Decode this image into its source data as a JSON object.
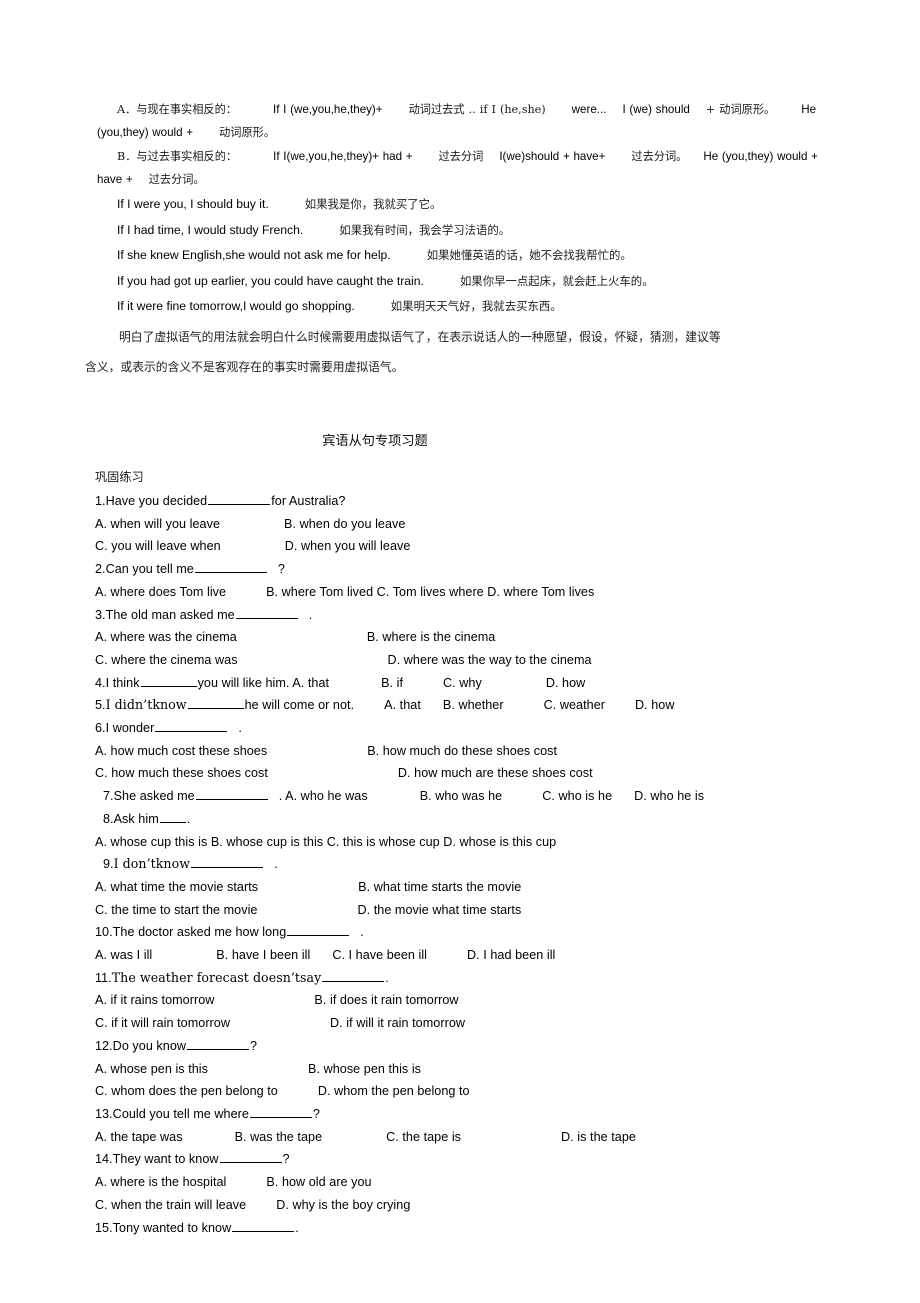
{
  "document": {
    "title": "宾语从句专项习题",
    "subtitle": "巩固练习"
  },
  "grammar_notes": {
    "rule_a": {
      "label": "A．",
      "name": "与现在事实相反的：",
      "part1": "If I (we,you,he,they)+",
      "part2": "动词过去式 .. if I (he,she)",
      "part3": "were...",
      "part4": "I (we)  should",
      "part5": "+  动词原形。",
      "part6": "He (you,they) would +",
      "part7": "动词原形。"
    },
    "rule_b": {
      "label": "B．",
      "name": "与过去事实相反的：",
      "part1": "If I(we,you,he,they)+ had +",
      "part2": "过去分词",
      "part3": "I(we)should + have+",
      "part4": "过去分词。",
      "part5": "He (you,they) would + have +",
      "part6": "过去分词。"
    },
    "examples": [
      {
        "en": "If I were you, I should buy it.",
        "cn": "如果我是你，我就买了它。"
      },
      {
        "en": "If I had time, I would study French.",
        "cn": "如果我有时间，我会学习法语的。"
      },
      {
        "en": "If she knew English,she would not ask me for help.",
        "cn": "如果她懂英语的话，她不会找我帮忙的。"
      },
      {
        "en": "If you had got up earlier, you could have caught the train.",
        "cn": "如果你早一点起床，就会赶上火车的。"
      },
      {
        "en": "If it were fine tomorrow,I would go shopping.",
        "cn": "如果明天天气好，我就去买东西。"
      }
    ],
    "summary_line1": "明白了虚拟语气的用法就会明白什么时候需要用虚拟语气了，在表示说话人的一种愿望，假设，怀疑，猜测，建议等",
    "summary_line2": "含义，或表示的含义不是客观存在的事实时需要用虚拟语气。"
  },
  "questions": [
    {
      "num": "1.",
      "stem_before": "Have you decided",
      "stem_after": "for Australia?",
      "rows": [
        [
          "A. when will you leave",
          "B. when do you leave"
        ],
        [
          "C. you will leave when",
          "D. when you will leave"
        ]
      ]
    },
    {
      "num": "2.",
      "stem_before": "Can you tell me",
      "stem_after": "?",
      "rows": [
        [
          "A. where does Tom live",
          "B. where Tom lived C. Tom lives where D. where Tom lives"
        ]
      ]
    },
    {
      "num": "3.",
      "stem_before": "The old man asked me",
      "stem_after": ".",
      "rows": [
        [
          "A. where was the cinema",
          "B. where is the cinema"
        ],
        [
          "C. where the cinema was",
          "D. where was the way to the cinema"
        ]
      ]
    },
    {
      "num": "4.",
      "stem_before": "I think",
      "stem_after": "you will like him. A. that",
      "inline_options": [
        "B. if",
        "C. why",
        "D. how"
      ]
    },
    {
      "num": "5.",
      "stem_before": "I didn’tknow",
      "stem_after": "he will come or not.",
      "inline_options": [
        "A. that",
        "B. whether",
        "C. weather",
        "D. how"
      ]
    },
    {
      "num": "6.",
      "stem_before": "I wonder",
      "stem_after": ".",
      "rows": [
        [
          "A. how much cost these shoes",
          "B. how much do these shoes cost"
        ],
        [
          "C. how much these shoes cost",
          "D. how much are these shoes cost"
        ]
      ]
    },
    {
      "num": "7.",
      "stem_before": "She asked me",
      "stem_after": ". A. who he was",
      "inline_options": [
        "B. who was he",
        "C. who is he",
        "D. who he is"
      ]
    },
    {
      "num": "8.",
      "stem_before": "Ask him",
      "stem_after": ".",
      "rows": [
        [
          "A. whose cup this is B. whose cup is this C. this is whose cup D. whose is this cup"
        ]
      ]
    },
    {
      "num": "9.",
      "stem_before": "I don’tknow",
      "stem_after": ".",
      "rows": [
        [
          "A. what time the movie starts",
          "B. what time starts the movie"
        ],
        [
          "C. the time to start the movie",
          "D. the movie what time starts"
        ]
      ]
    },
    {
      "num": "10.",
      "stem_before": "The doctor asked me how long",
      "stem_after": ".",
      "inline_options": [
        "A. was I ill",
        "B.    have I been ill",
        "C. I have been ill",
        "D. I had been ill"
      ]
    },
    {
      "num": "11.",
      "stem_before": "The weather forecast doesn’tsay",
      "stem_after": ".",
      "rows": [
        [
          "A. if it rains tomorrow",
          "B. if does it rain tomorrow"
        ],
        [
          "C. if it will rain tomorrow",
          "D. if will it rain tomorrow"
        ]
      ]
    },
    {
      "num": "12.",
      "stem_before": "Do you know",
      "stem_after": "?",
      "rows": [
        [
          "A. whose pen is this",
          "B. whose pen this is"
        ],
        [
          "C. whom does the pen belong to",
          "D. whom the pen belong to"
        ]
      ]
    },
    {
      "num": "13.",
      "stem_before": "Could you tell me where",
      "stem_after": "?",
      "inline_options": [
        "A. the tape was",
        "B. was the tape",
        "C. the tape is",
        "D. is the tape"
      ]
    },
    {
      "num": "14.",
      "stem_before": "They want to know",
      "stem_after": "?",
      "rows": [
        [
          "A. where is the hospital",
          "B. how old are you"
        ],
        [
          "C. when the train will leave",
          "D. why is the boy crying"
        ]
      ]
    },
    {
      "num": "15.",
      "stem_before": "Tony wanted to know",
      "stem_after": ".",
      "rows": []
    }
  ]
}
